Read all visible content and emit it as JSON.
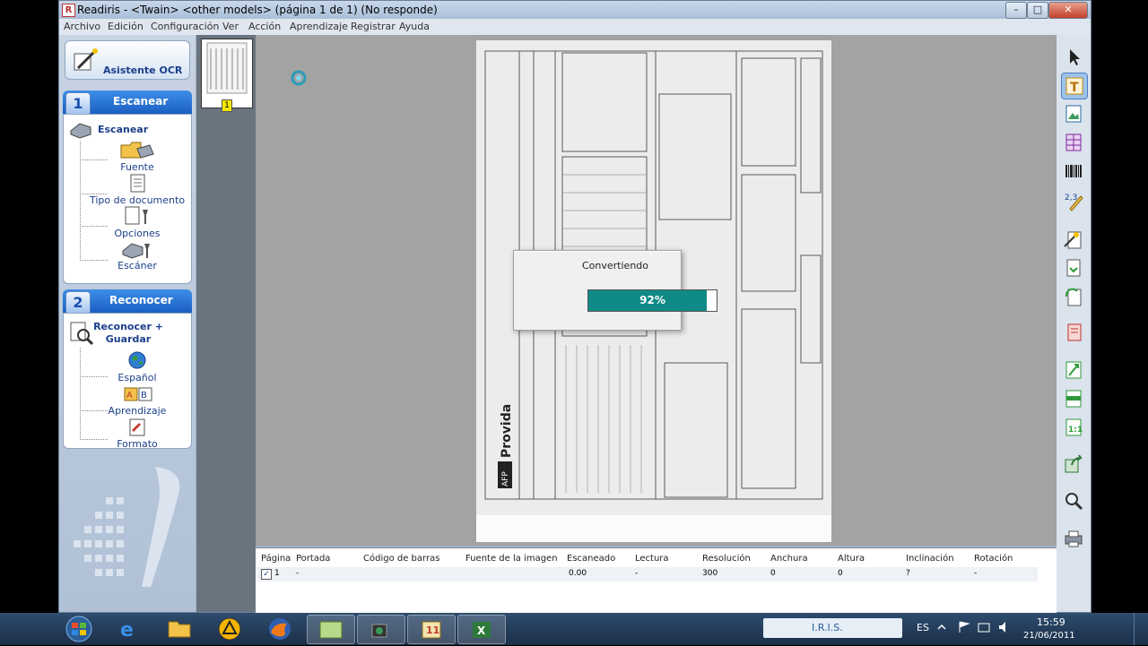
{
  "window": {
    "title": "Readiris - <Twain> <other models> (página 1 de 1) (No responde)",
    "controls": {
      "minimize": "–",
      "maximize": "□",
      "close": "✕"
    }
  },
  "menu": [
    "Archivo",
    "Edición",
    "Configuración",
    "Ver",
    "Acción",
    "Aprendizaje",
    "Registrar",
    "Ayuda"
  ],
  "wizard": {
    "label": "Asistente OCR"
  },
  "scan_section": {
    "number": "1",
    "header": "Escanear",
    "main_action": "Escanear",
    "items": [
      "Fuente",
      "Tipo de documento",
      "Opciones",
      "Escáner"
    ]
  },
  "recognize_section": {
    "number": "2",
    "header": "Reconocer",
    "main_action": "Reconocer + Guardar",
    "items": [
      "Español",
      "Aprendizaje",
      "Formato"
    ]
  },
  "thumbnail": {
    "page_number": "1"
  },
  "dialog": {
    "title": "Convertiendo",
    "progress": 0.92,
    "progress_label": "92%"
  },
  "document": {
    "brand": "Provida",
    "brand_prefix": "AFP"
  },
  "table": {
    "columns": [
      "Página",
      "Portada",
      "Código de barras",
      "Fuente de la imagen",
      "Escaneado",
      "Lectura",
      "Resolución",
      "Anchura",
      "Altura",
      "Inclinación",
      "Rotación"
    ],
    "rows": [
      {
        "page": "1",
        "checked": true,
        "portada": "-",
        "barcode": "",
        "source": "",
        "escaneado": "0.00",
        "lectura": "-",
        "resolucion": "300",
        "anchura": "0",
        "altura": "0",
        "inclinacion": "?",
        "rotacion": "-"
      }
    ]
  },
  "taskbar": {
    "iris_label": "I.R.I.S.",
    "language": "ES",
    "time": "15:59",
    "date": "21/06/2011"
  },
  "colors": {
    "progress_fill": "#0f8a86",
    "section_header": "#2a75d8",
    "accent_blue": "#1b3f8b"
  }
}
